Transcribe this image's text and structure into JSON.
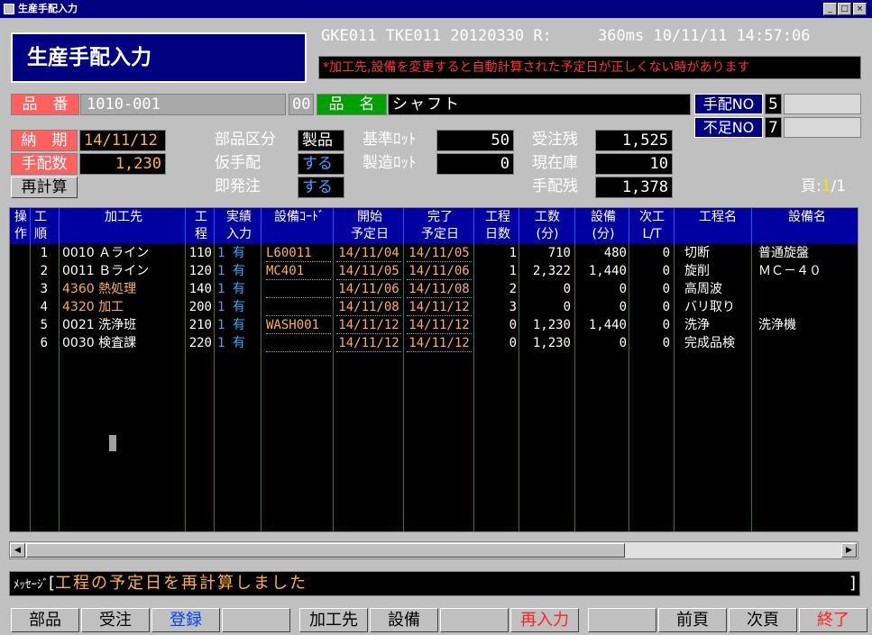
{
  "window": {
    "title": "生産手配入力"
  },
  "header": {
    "title": "生産手配入力",
    "sysinfo": "GKE011 TKE011 20120330 R:     360ms 10/11/11 14:57:06",
    "warning": "*加工先,設備を変更すると自動計算された予定日が正しくない時があります"
  },
  "item": {
    "hinban_label": "品　番",
    "hinban": "1010-001",
    "hinban_suffix": "00",
    "hinmei_label": "品　名",
    "hinmei": "シャフト",
    "tehai_no_label": "手配NO",
    "tehai_no": "5",
    "fusoku_no_label": "不足NO",
    "fusoku_no": "7"
  },
  "form": {
    "noki_label": "納　期",
    "noki": "14/11/12",
    "tehaisu_label": "手配数",
    "tehaisu": "1,230",
    "recalc_button": "再計算",
    "buhin_kubun_label": "部品区分",
    "buhin_kubun": "製品",
    "kari_tehai_label": "仮手配",
    "kari_tehai": "する",
    "sokuhatchu_label": "即発注",
    "sokuhatchu": "する",
    "kijun_lot_label": "基準ﾛｯﾄ",
    "kijun_lot": "50",
    "seizo_lot_label": "製造ﾛｯﾄ",
    "seizo_lot": "0",
    "juchuzan_label": "受注残",
    "juchuzan": "1,525",
    "genzaiko_label": "現在庫",
    "genzaiko": "10",
    "tehaizan_label": "手配残",
    "tehaizan": "1,378",
    "page_label": "頁:",
    "page_current": "1",
    "page_total": "/1"
  },
  "grid": {
    "headers": [
      "操\n作",
      "工\n順",
      "加工先",
      "工\n程",
      "実績\n入力",
      "設備ｺｰﾄﾞ",
      "開始\n予定日",
      "完了\n予定日",
      "工程\n日数",
      "工数\n(分)",
      "設備\n(分)",
      "次工\nL/T",
      "工程名",
      "設備名"
    ],
    "rows": [
      {
        "seq": "1",
        "maker": "0010 Ａライン",
        "proc": "110",
        "jisseki": "1 有",
        "equip_code": "L60011",
        "start": "14/11/04",
        "end": "14/11/05",
        "days": "1",
        "manhours": "710",
        "equip_min": "480",
        "next_lt": "0",
        "proc_name": "切断",
        "equip_name": "普通旋盤"
      },
      {
        "seq": "2",
        "maker": "0011 Ｂライン",
        "proc": "120",
        "jisseki": "1 有",
        "equip_code": "MC401",
        "start": "14/11/05",
        "end": "14/11/06",
        "days": "1",
        "manhours": "2,322",
        "equip_min": "1,440",
        "next_lt": "0",
        "proc_name": "旋削",
        "equip_name": "ＭＣ－４０"
      },
      {
        "seq": "3",
        "maker": "4360 熱処理",
        "proc": "140",
        "jisseki": "1 有",
        "equip_code": "",
        "start": "14/11/06",
        "end": "14/11/08",
        "days": "2",
        "manhours": "0",
        "equip_min": "0",
        "next_lt": "0",
        "proc_name": "高周波",
        "equip_name": ""
      },
      {
        "seq": "4",
        "maker": "4320 加工",
        "proc": "200",
        "jisseki": "1 有",
        "equip_code": "",
        "start": "14/11/08",
        "end": "14/11/12",
        "days": "3",
        "manhours": "0",
        "equip_min": "0",
        "next_lt": "0",
        "proc_name": "バリ取り",
        "equip_name": ""
      },
      {
        "seq": "5",
        "maker": "0021 洗浄班",
        "proc": "210",
        "jisseki": "1 有",
        "equip_code": "WASH001",
        "start": "14/11/12",
        "end": "14/11/12",
        "days": "0",
        "manhours": "1,230",
        "equip_min": "1,440",
        "next_lt": "0",
        "proc_name": "洗浄",
        "equip_name": "洗浄機"
      },
      {
        "seq": "6",
        "maker": "0030 検査課",
        "proc": "220",
        "jisseki": "1 有",
        "equip_code": "",
        "start": "14/11/12",
        "end": "14/11/12",
        "days": "0",
        "manhours": "1,230",
        "equip_min": "0",
        "next_lt": "0",
        "proc_name": "完成品検",
        "equip_name": ""
      }
    ]
  },
  "message": {
    "label": "ﾒｯｾｰｼﾞ",
    "open": "[",
    "text": "工程の予定日を再計算しました",
    "close": "]"
  },
  "fkeys": [
    "部品",
    "受注",
    "登録",
    "",
    "加工先",
    "設備",
    "",
    "再入力",
    "",
    "前頁",
    "次頁",
    "終了"
  ],
  "colors": {
    "navy": "#000080",
    "label_red": "#ff6060",
    "label_green": "#00a000",
    "orange": "#ffb040",
    "warning_red": "#ff3030"
  },
  "icons": {
    "system_menu": "window-icon",
    "minimize": "minimize-icon",
    "maximize": "maximize-icon",
    "close": "close-icon"
  }
}
